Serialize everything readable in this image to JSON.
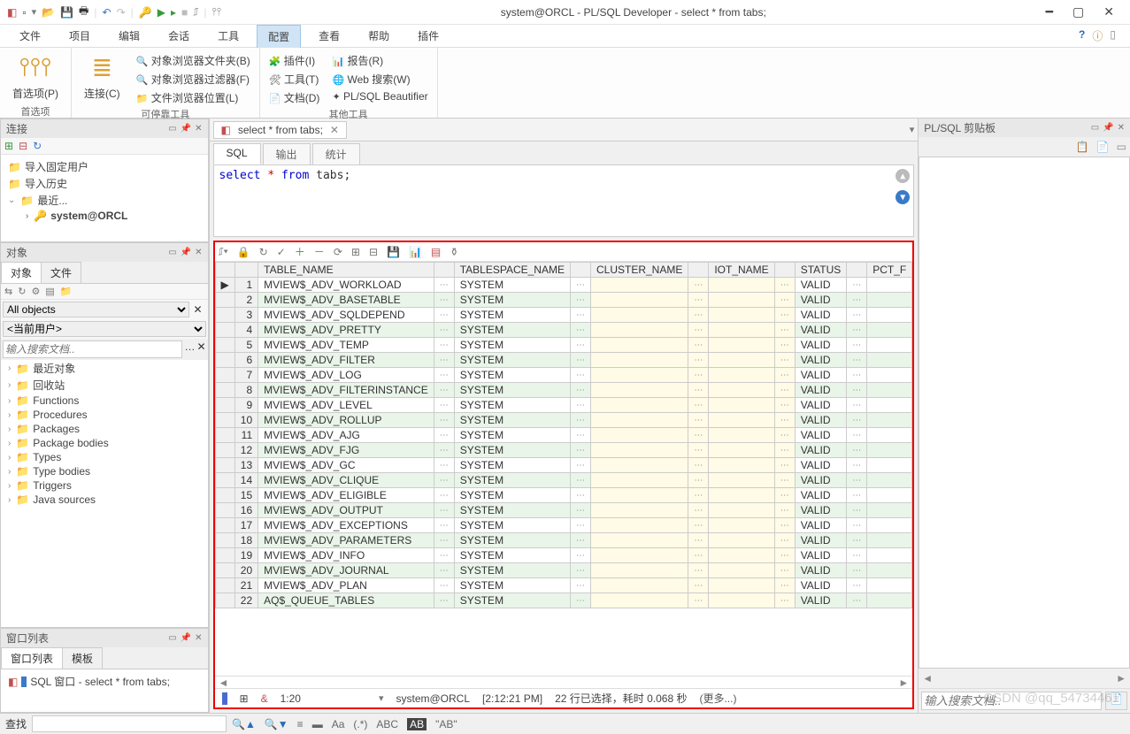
{
  "title": "system@ORCL - PL/SQL Developer - select * from tabs;",
  "menus": [
    "文件",
    "项目",
    "编辑",
    "会话",
    "工具",
    "配置",
    "查看",
    "帮助",
    "插件"
  ],
  "active_menu": "配置",
  "ribbon": {
    "group1_label": "首选项",
    "prefs_btn": "首选项(P)",
    "connect_btn": "连接(C)",
    "group2_label": "可停靠工具",
    "obj_browser_folder": "对象浏览器文件夹(B)",
    "obj_browser_filter": "对象浏览器过滤器(F)",
    "file_browser_loc": "文件浏览器位置(L)",
    "group3_label": "其他工具",
    "plugin": "插件(I)",
    "tools": "工具(T)",
    "docs": "文档(D)",
    "report": "报告(R)",
    "web_search": "Web 搜索(W)",
    "beautifier": "PL/SQL Beautifier"
  },
  "left": {
    "connect_title": "连接",
    "import_fixed_user": "导入固定用户",
    "import_history": "导入历史",
    "recent": "最近...",
    "current_conn": "system@ORCL",
    "objects_title": "对象",
    "obj_tabs": [
      "对象",
      "文件"
    ],
    "all_objects": "All objects",
    "current_user": "<当前用户>",
    "search_ph": "输入搜索文档..",
    "obj_list": [
      "最近对象",
      "回收站",
      "Functions",
      "Procedures",
      "Packages",
      "Package bodies",
      "Types",
      "Type bodies",
      "Triggers",
      "Java sources"
    ],
    "winlist_title": "窗口列表",
    "winlist_tabs": [
      "窗口列表",
      "模板"
    ],
    "winlist_item": "SQL 窗口 - select * from tabs;"
  },
  "editor": {
    "tab_label": "select * from tabs;",
    "sub_tabs": [
      "SQL",
      "输出",
      "统计"
    ],
    "sql_text_kw1": "select",
    "sql_text_star": "*",
    "sql_text_kw2": "from",
    "sql_text_id": "tabs",
    "sql_text_semi": ";"
  },
  "grid": {
    "columns": [
      "TABLE_NAME",
      "TABLESPACE_NAME",
      "CLUSTER_NAME",
      "IOT_NAME",
      "STATUS",
      "PCT_F"
    ],
    "rows": [
      {
        "n": 1,
        "t": "MVIEW$_ADV_WORKLOAD",
        "ts": "SYSTEM",
        "st": "VALID"
      },
      {
        "n": 2,
        "t": "MVIEW$_ADV_BASETABLE",
        "ts": "SYSTEM",
        "st": "VALID"
      },
      {
        "n": 3,
        "t": "MVIEW$_ADV_SQLDEPEND",
        "ts": "SYSTEM",
        "st": "VALID"
      },
      {
        "n": 4,
        "t": "MVIEW$_ADV_PRETTY",
        "ts": "SYSTEM",
        "st": "VALID"
      },
      {
        "n": 5,
        "t": "MVIEW$_ADV_TEMP",
        "ts": "SYSTEM",
        "st": "VALID"
      },
      {
        "n": 6,
        "t": "MVIEW$_ADV_FILTER",
        "ts": "SYSTEM",
        "st": "VALID"
      },
      {
        "n": 7,
        "t": "MVIEW$_ADV_LOG",
        "ts": "SYSTEM",
        "st": "VALID"
      },
      {
        "n": 8,
        "t": "MVIEW$_ADV_FILTERINSTANCE",
        "ts": "SYSTEM",
        "st": "VALID"
      },
      {
        "n": 9,
        "t": "MVIEW$_ADV_LEVEL",
        "ts": "SYSTEM",
        "st": "VALID"
      },
      {
        "n": 10,
        "t": "MVIEW$_ADV_ROLLUP",
        "ts": "SYSTEM",
        "st": "VALID"
      },
      {
        "n": 11,
        "t": "MVIEW$_ADV_AJG",
        "ts": "SYSTEM",
        "st": "VALID"
      },
      {
        "n": 12,
        "t": "MVIEW$_ADV_FJG",
        "ts": "SYSTEM",
        "st": "VALID"
      },
      {
        "n": 13,
        "t": "MVIEW$_ADV_GC",
        "ts": "SYSTEM",
        "st": "VALID"
      },
      {
        "n": 14,
        "t": "MVIEW$_ADV_CLIQUE",
        "ts": "SYSTEM",
        "st": "VALID"
      },
      {
        "n": 15,
        "t": "MVIEW$_ADV_ELIGIBLE",
        "ts": "SYSTEM",
        "st": "VALID"
      },
      {
        "n": 16,
        "t": "MVIEW$_ADV_OUTPUT",
        "ts": "SYSTEM",
        "st": "VALID"
      },
      {
        "n": 17,
        "t": "MVIEW$_ADV_EXCEPTIONS",
        "ts": "SYSTEM",
        "st": "VALID"
      },
      {
        "n": 18,
        "t": "MVIEW$_ADV_PARAMETERS",
        "ts": "SYSTEM",
        "st": "VALID"
      },
      {
        "n": 19,
        "t": "MVIEW$_ADV_INFO",
        "ts": "SYSTEM",
        "st": "VALID"
      },
      {
        "n": 20,
        "t": "MVIEW$_ADV_JOURNAL",
        "ts": "SYSTEM",
        "st": "VALID"
      },
      {
        "n": 21,
        "t": "MVIEW$_ADV_PLAN",
        "ts": "SYSTEM",
        "st": "VALID"
      },
      {
        "n": 22,
        "t": "AQ$_QUEUE_TABLES",
        "ts": "SYSTEM",
        "st": "VALID"
      }
    ]
  },
  "status": {
    "cursor": "1:20",
    "sigil": "&",
    "conn": "system@ORCL",
    "time": "[2:12:21 PM]",
    "msg": "22 行已选择，耗时 0.068 秒",
    "more": "(更多...)"
  },
  "right": {
    "title": "PL/SQL 剪贴板",
    "search_ph": "输入搜索文档.."
  },
  "find_title": "查找",
  "watermark": "CSDN @qq_54734461"
}
